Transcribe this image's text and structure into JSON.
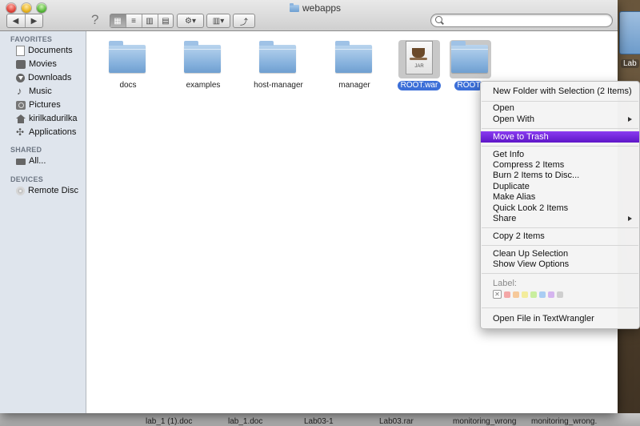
{
  "window": {
    "title": "webapps"
  },
  "toolbar": {
    "back": "◀",
    "forward": "▶",
    "help": "?",
    "views": [
      "▦",
      "≡",
      "▥",
      "▤"
    ],
    "action": "⚙▾",
    "arrange": "▥▾",
    "share": "⤴",
    "search_value": ""
  },
  "sidebar": {
    "favorites_header": "FAVORITES",
    "favorites": [
      {
        "label": "Documents",
        "icon": "documents-icon"
      },
      {
        "label": "Movies",
        "icon": "movies-icon"
      },
      {
        "label": "Downloads",
        "icon": "downloads-icon"
      },
      {
        "label": "Music",
        "icon": "music-icon"
      },
      {
        "label": "Pictures",
        "icon": "pictures-icon"
      },
      {
        "label": "kirilkadurilka",
        "icon": "home-icon"
      },
      {
        "label": "Applications",
        "icon": "applications-icon"
      }
    ],
    "shared_header": "SHARED",
    "shared": [
      {
        "label": "All...",
        "icon": "network-icon"
      }
    ],
    "devices_header": "DEVICES",
    "devices": [
      {
        "label": "Remote Disc",
        "icon": "disc-icon"
      }
    ]
  },
  "files": [
    {
      "name": "docs",
      "type": "folder",
      "selected": false
    },
    {
      "name": "examples",
      "type": "folder",
      "selected": false
    },
    {
      "name": "host-manager",
      "type": "folder",
      "selected": false
    },
    {
      "name": "manager",
      "type": "folder",
      "selected": false
    },
    {
      "name": "ROOT.war",
      "type": "jar",
      "selected": true,
      "badge": "JAR"
    },
    {
      "name": "ROOT",
      "type": "folder",
      "selected": true
    }
  ],
  "context_menu": {
    "items": [
      "New Folder with Selection (2 Items)",
      "Open",
      "Open With",
      "Move to Trash",
      "Get Info",
      "Compress 2 Items",
      "Burn 2 Items to Disc...",
      "Duplicate",
      "Make Alias",
      "Quick Look 2 Items",
      "Share",
      "Copy 2 Items",
      "Clean Up Selection",
      "Show View Options",
      "Open File in TextWrangler"
    ],
    "highlighted": "Move to Trash",
    "label_title": "Label:",
    "label_none": "✕",
    "label_colors": [
      "#f4a7a7",
      "#f6c99a",
      "#f3ec9c",
      "#c9ee9e",
      "#a9cdf3",
      "#d5b5ef",
      "#cfcfcf"
    ]
  },
  "desktop": {
    "right_icon_label": "Lab",
    "bottom_files": [
      "lab_1 (1).doc",
      "lab_1.doc",
      "Lab03-1",
      "Lab03.rar",
      "monitoring_wrong",
      "monitoring_wrong."
    ]
  }
}
